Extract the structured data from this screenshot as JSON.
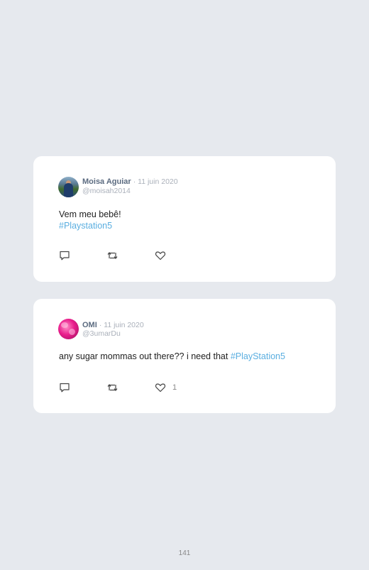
{
  "tweets": [
    {
      "author": "Moisa Aguiar",
      "date": "· 11 juin 2020",
      "handle": "@moisah2014",
      "text": "Vem meu bebê!",
      "hashtag": "#Playstation5",
      "likes": "",
      "avatar_icon": "user-photo-avatar"
    },
    {
      "author": "OMI",
      "date": "· 11 juin 2020",
      "handle": "@3umarDu",
      "text": "any sugar mommas out there?? i need that ",
      "hashtag": "#PlayStation5",
      "likes": "1",
      "avatar_icon": "pink-flower-avatar"
    }
  ],
  "page_number": "141",
  "colors": {
    "background": "#e6e9ee",
    "card": "#ffffff",
    "hashtag": "#5aaee0",
    "author": "#5b6b80",
    "muted": "#aab0ba"
  }
}
